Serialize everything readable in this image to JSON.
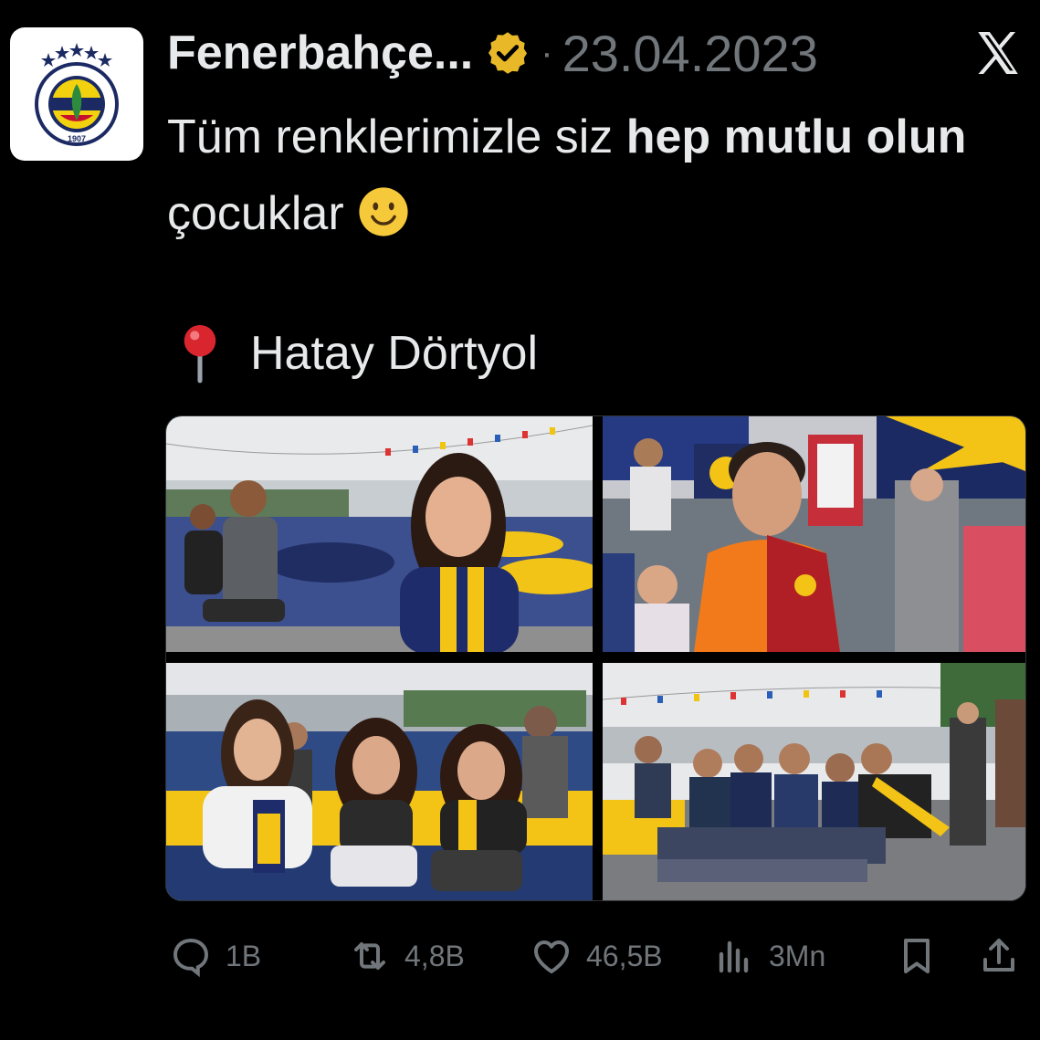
{
  "tweet": {
    "author_name": "Fenerbahçe...",
    "date": "23.04.2023",
    "text_part1": "Tüm renklerimizle siz ",
    "text_bold1": "hep mutlu olun",
    "text_part2": " çocuklar",
    "location": "Hatay Dörtyol"
  },
  "logo": {
    "club_text": "FENERBAHÇE SPOR KULÜBÜ",
    "year": "1907"
  },
  "media": {
    "photos": [
      {
        "desc": "girl-in-fenerbahce-jersey"
      },
      {
        "desc": "boy-in-galatasaray-jersey"
      },
      {
        "desc": "three-girls-sitting"
      },
      {
        "desc": "group-of-boys-sitting"
      }
    ]
  },
  "actions": {
    "replies": "1B",
    "retweets": "4,8B",
    "likes": "46,5B",
    "views": "3Mn"
  },
  "colors": {
    "background": "#000000",
    "text": "#e7e9ea",
    "muted": "#71767b",
    "verified_gold": "#e8b829"
  }
}
